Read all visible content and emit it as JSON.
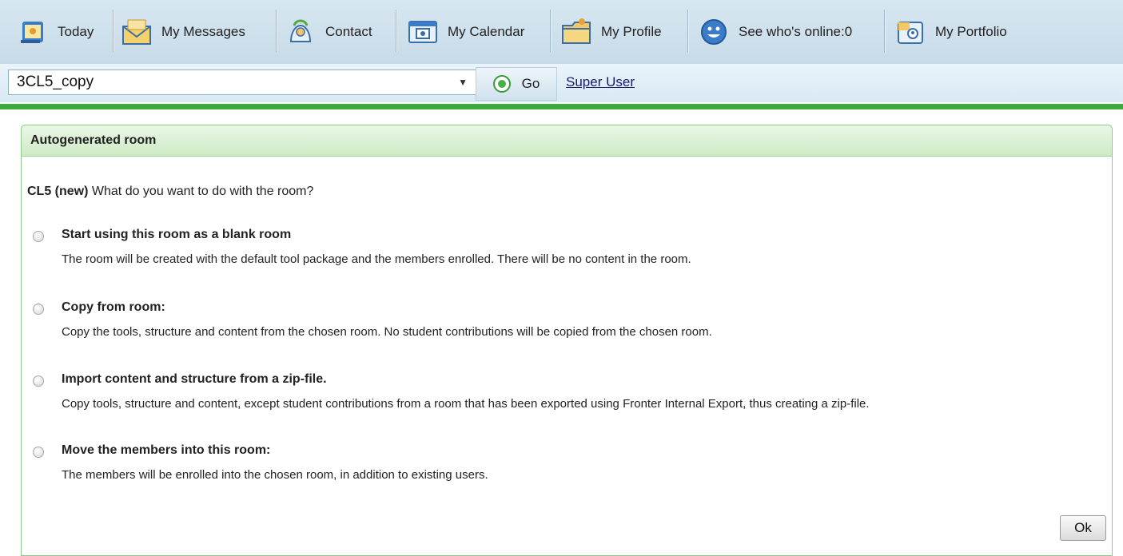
{
  "nav": {
    "items": [
      {
        "label": "Today",
        "icon": "today-icon"
      },
      {
        "label": "My Messages",
        "icon": "envelope-icon"
      },
      {
        "label": "Contact",
        "icon": "contact-icon"
      },
      {
        "label": "My Calendar",
        "icon": "calendar-icon"
      },
      {
        "label": "My Profile",
        "icon": "folder-profile-icon"
      },
      {
        "label": "See who's online:0",
        "icon": "smiley-icon"
      },
      {
        "label": "My Portfolio",
        "icon": "portfolio-icon"
      }
    ]
  },
  "toolbar": {
    "room_select_value": "3CL5_copy",
    "go_label": "Go",
    "user_link": "Super User"
  },
  "panel": {
    "title": "Autogenerated room",
    "question_bold": "CL5 (new)",
    "question_text": " What do you want to do with the room?",
    "options": [
      {
        "title": "Start using this room as a blank room",
        "desc": "The room will be created with the default tool package and the members enrolled. There will be no content in the room."
      },
      {
        "title": "Copy from room:",
        "desc": "Copy the tools, structure and content from the chosen room. No student contributions will be copied from the chosen room."
      },
      {
        "title": "Import content and structure from a zip-file.",
        "desc": "Copy tools, structure and content, except student contributions from a room that has been exported using Fronter Internal Export, thus creating a zip-file."
      },
      {
        "title": "Move the members into this room:",
        "desc": "The members will be enrolled into the chosen room, in addition to existing users."
      }
    ],
    "ok_label": "Ok"
  },
  "colors": {
    "accent_green": "#3daa3d",
    "nav_bg": "#c7dbe8",
    "panel_header_bg": "#cfeac6"
  }
}
